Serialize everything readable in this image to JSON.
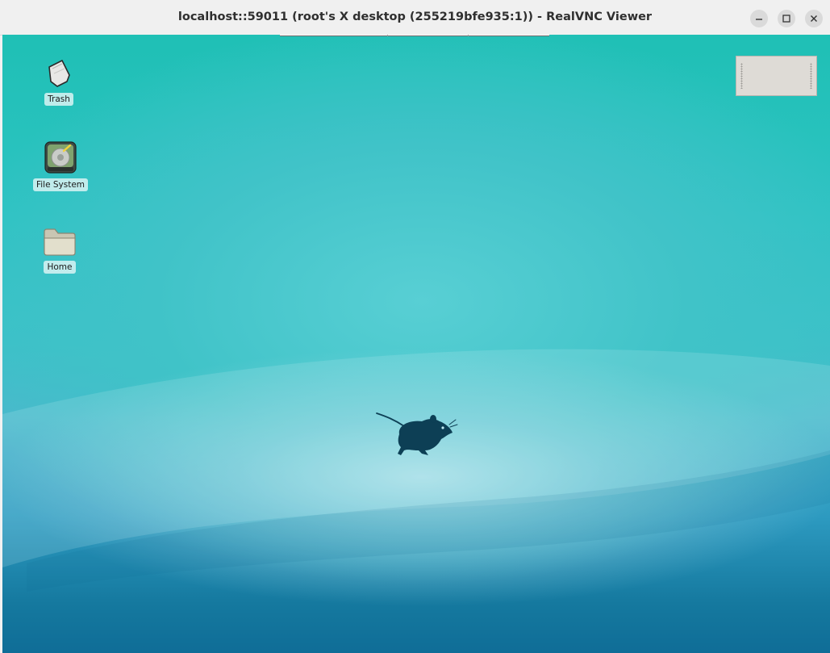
{
  "window": {
    "title": "localhost::59011 (root's X desktop (255219bfe935:1)) - RealVNC Viewer"
  },
  "desktop_icons": [
    {
      "label": "Trash",
      "icon": "trash-icon"
    },
    {
      "label": "File System",
      "icon": "hard-drive-icon"
    },
    {
      "label": "Home",
      "icon": "folder-icon"
    }
  ],
  "wallpaper": {
    "logo": "xfce-mouse-logo"
  },
  "colors": {
    "wallpaper_top": "#1fc0b5",
    "wallpaper_bottom": "#0f6d97",
    "titlebar": "#f0f0f0"
  }
}
